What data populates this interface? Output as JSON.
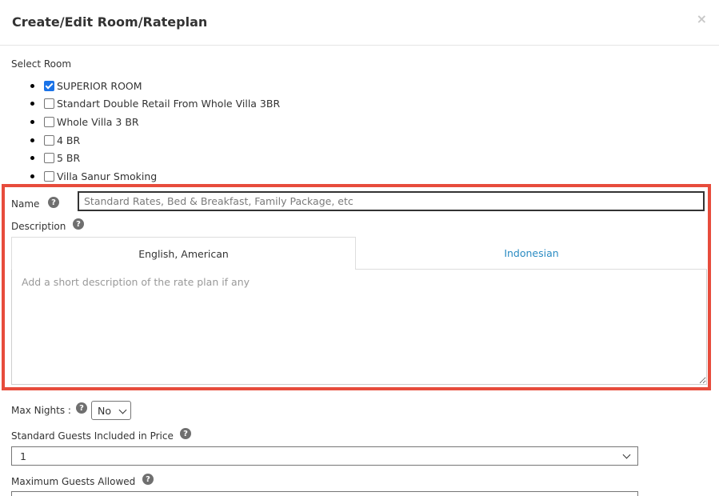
{
  "modal": {
    "title": "Create/Edit Room/Rateplan",
    "close_label": "×"
  },
  "select_room": {
    "label": "Select Room",
    "rooms": [
      {
        "label": "SUPERIOR ROOM",
        "checked": true
      },
      {
        "label": "Standart Double Retail From Whole Villa 3BR",
        "checked": false
      },
      {
        "label": "Whole Villa 3 BR",
        "checked": false
      },
      {
        "label": "4 BR",
        "checked": false
      },
      {
        "label": "5 BR",
        "checked": false
      },
      {
        "label": "Villa Sanur Smoking",
        "checked": false
      }
    ]
  },
  "name_field": {
    "label": "Name",
    "placeholder": "Standard Rates, Bed & Breakfast, Family Package, etc",
    "help_icon": "question-circle-icon"
  },
  "description": {
    "label": "Description",
    "help_icon": "question-circle-icon",
    "tabs": [
      {
        "label": "English, American",
        "active": true
      },
      {
        "label": "Indonesian",
        "active": false
      }
    ],
    "placeholder": "Add a short description of the rate plan if any"
  },
  "max_nights": {
    "label": "Max Nights :",
    "value": "No"
  },
  "standard_guests": {
    "label": "Standard Guests Included in Price",
    "value": "1"
  },
  "max_guests": {
    "label": "Maximum Guests Allowed"
  },
  "colors": {
    "highlight": "#e74c3c",
    "tab_link": "#2a8bc2"
  }
}
